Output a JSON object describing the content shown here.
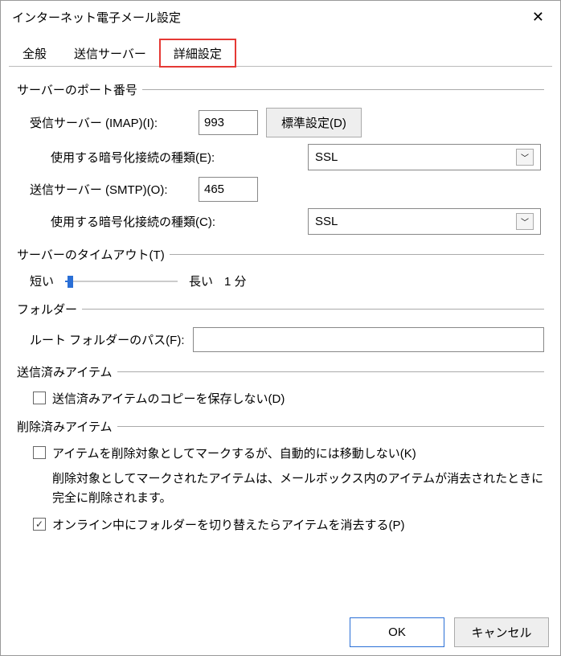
{
  "window": {
    "title": "インターネット電子メール設定"
  },
  "tabs": {
    "general": "全般",
    "outgoing": "送信サーバー",
    "advanced": "詳細設定"
  },
  "serverPorts": {
    "title": "サーバーのポート番号",
    "imapLabel": "受信サーバー (IMAP)(I):",
    "imapValue": "993",
    "defaultsButton": "標準設定(D)",
    "encIncomingLabel": "使用する暗号化接続の種類(E):",
    "encIncomingValue": "SSL",
    "smtpLabel": "送信サーバー (SMTP)(O):",
    "smtpValue": "465",
    "encOutgoingLabel": "使用する暗号化接続の種類(C):",
    "encOutgoingValue": "SSL"
  },
  "timeout": {
    "title": "サーバーのタイムアウト(T)",
    "shortLabel": "短い",
    "longLabel": "長い",
    "valueLabel": "1 分"
  },
  "folders": {
    "title": "フォルダー",
    "rootLabel": "ルート フォルダーのパス(F):",
    "rootValue": ""
  },
  "sentItems": {
    "title": "送信済みアイテム",
    "checkboxLabel": "送信済みアイテムのコピーを保存しない(D)"
  },
  "deletedItems": {
    "title": "削除済みアイテム",
    "markLabel": "アイテムを削除対象としてマークするが、自動的には移動しない(K)",
    "markHelp": "削除対象としてマークされたアイテムは、メールボックス内のアイテムが消去されたときに完全に削除されます。",
    "purgeLabel": "オンライン中にフォルダーを切り替えたらアイテムを消去する(P)"
  },
  "footer": {
    "ok": "OK",
    "cancel": "キャンセル"
  }
}
